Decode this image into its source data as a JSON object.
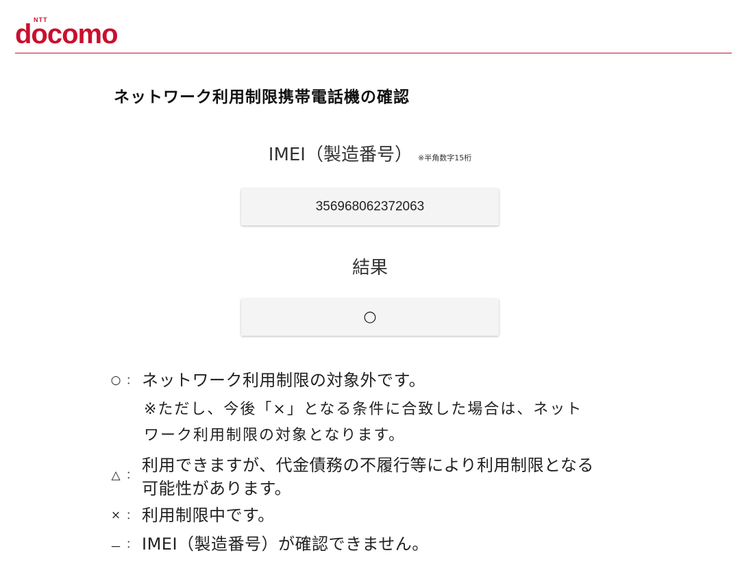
{
  "brand": {
    "ntt": "NTT",
    "name": "docomo",
    "color": "#c8102e"
  },
  "page": {
    "title": "ネットワーク利用制限携帯電話機の確認"
  },
  "imei": {
    "label": "IMEI（製造番号）",
    "note": "※半角数字15桁",
    "value": "356968062372063"
  },
  "result": {
    "label": "結果",
    "value": "○"
  },
  "legend": {
    "separator": "：",
    "items": [
      {
        "symbol": "○",
        "lines": [
          "ネットワーク利用制限の対象外です。"
        ],
        "notes": [
          "※ただし、今後「×」となる条件に合致した場合は、ネット",
          "ワーク利用制限の対象となります。"
        ]
      },
      {
        "symbol": "△",
        "lines": [
          "利用できますが、代金債務の不履行等により利用制限となる",
          "可能性があります。"
        ]
      },
      {
        "symbol": "×",
        "lines": [
          "利用制限中です。"
        ]
      },
      {
        "symbol": "－",
        "lines": [
          "IMEI（製造番号）が確認できません。"
        ]
      }
    ]
  }
}
